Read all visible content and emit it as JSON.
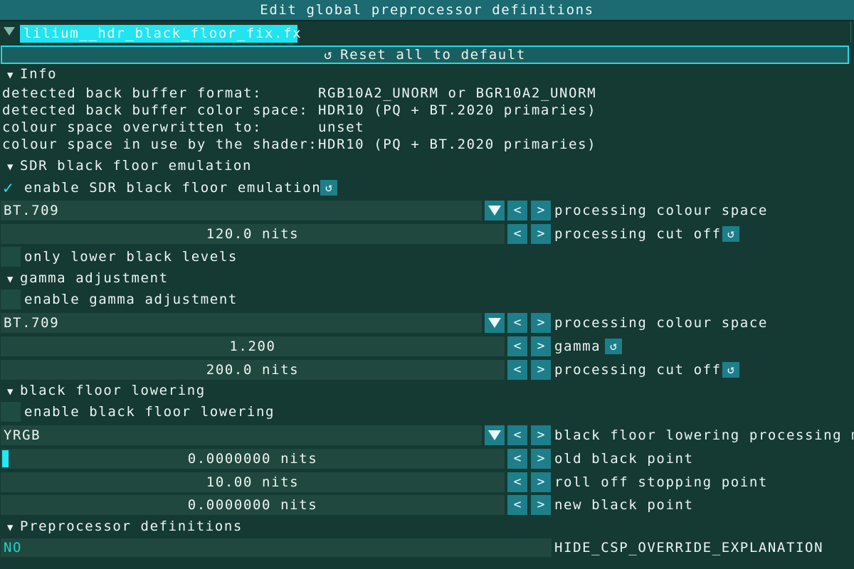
{
  "window": {
    "title": "Edit global preprocessor definitions"
  },
  "tab": {
    "label": "lilium__hdr_black_floor_fix.fx"
  },
  "reset_all": {
    "label": "Reset all to default",
    "icon": "reset-icon"
  },
  "info": {
    "header": "Info",
    "rows": [
      {
        "key": "detected back buffer format:",
        "value": "RGB10A2_UNORM or BGR10A2_UNORM"
      },
      {
        "key": "detected back buffer color space:",
        "value": "HDR10 (PQ + BT.2020 primaries)"
      },
      {
        "key": "colour space overwritten to:",
        "value": "unset"
      },
      {
        "key": "colour space in use by the shader:",
        "value": "HDR10 (PQ + BT.2020 primaries)"
      }
    ]
  },
  "sdr": {
    "header": "SDR black floor emulation",
    "enable_label": "enable SDR black floor emulation",
    "enabled": true,
    "colour_space_value": "BT.709",
    "colour_space_label": "processing colour space",
    "cutoff_value": "120.0 nits",
    "cutoff_label": "processing cut off",
    "only_lower_label": "only lower black levels"
  },
  "gamma": {
    "header": "gamma adjustment",
    "enable_label": "enable gamma adjustment",
    "colour_space_value": "BT.709",
    "colour_space_label": "processing colour space",
    "gamma_value": "1.200",
    "gamma_label": "gamma",
    "cutoff_value": "200.0 nits",
    "cutoff_label": "processing cut off"
  },
  "lowering": {
    "header": "black floor lowering",
    "enable_label": "enable black floor lowering",
    "mode_value": "YRGB",
    "mode_label": "black floor lowering processing m",
    "old_black_value": "0.0000000 nits",
    "old_black_label": "old black point",
    "rolloff_value": "10.00 nits",
    "rolloff_label": "roll off stopping point",
    "new_black_value": "0.0000000 nits",
    "new_black_label": "new black point"
  },
  "preproc": {
    "header": "Preprocessor definitions",
    "value": "NO",
    "label": "HIDE_CSP_OVERRIDE_EXPLANATION"
  },
  "buttons": {
    "left": "<",
    "right": ">",
    "arrow": "▼",
    "reset_glyph": "↺",
    "check": "✓"
  },
  "colors": {
    "accent": "#21e4f0",
    "button": "#1e7f8a",
    "background": "#143a33",
    "field": "#20483f"
  }
}
